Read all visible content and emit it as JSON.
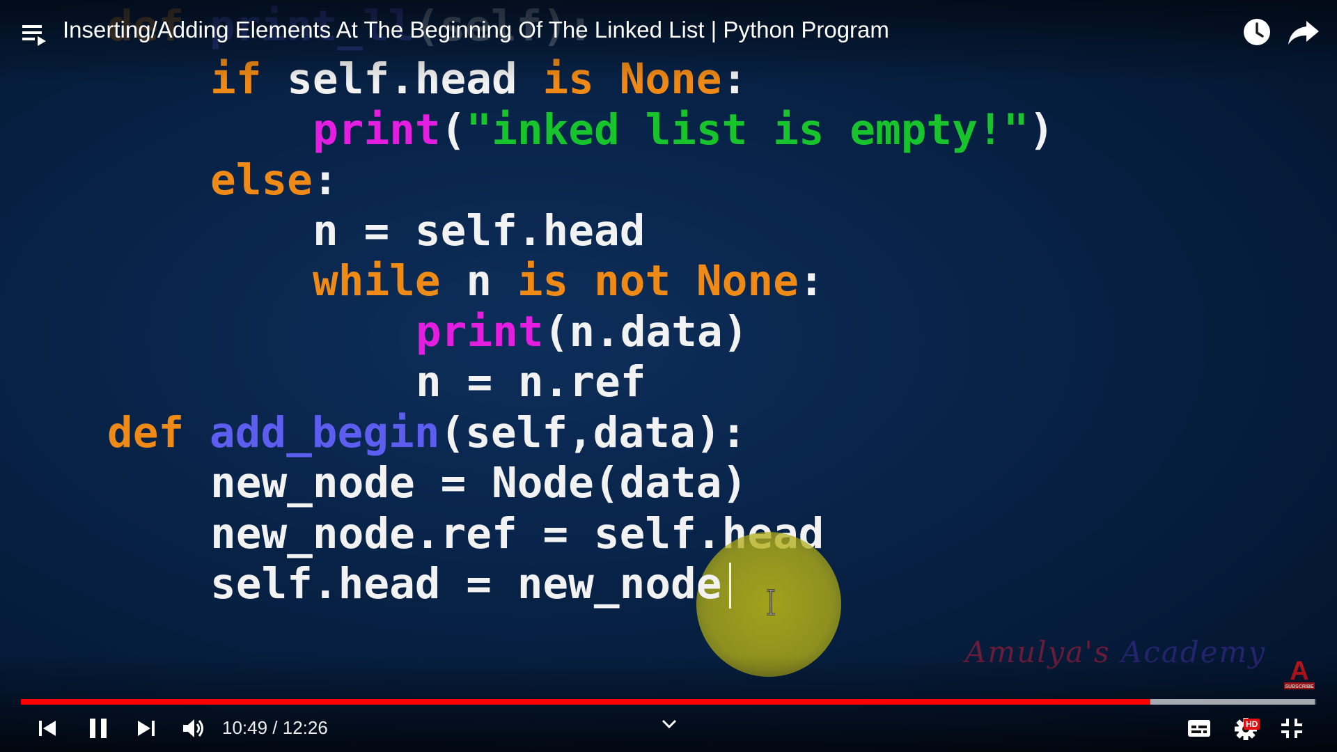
{
  "player": {
    "title": "Inserting/Adding Elements At The Beginning Of The Linked List | Python Program",
    "time_current": "10:49",
    "time_separator": " / ",
    "time_total": "12:26",
    "progress_played_fraction": 0.872,
    "progress_buffered_fraction": 0.999,
    "hd_badge": "HD",
    "icons": {
      "playlist": "playlist-icon",
      "watch_later": "clock-icon",
      "share": "share-arrow-icon",
      "previous": "skip-previous-icon",
      "pause": "pause-icon",
      "next": "skip-next-icon",
      "volume": "volume-icon",
      "chevron": "chevron-down-icon",
      "captions": "captions-icon",
      "settings": "gear-icon",
      "exit_fullscreen": "exit-fullscreen-icon"
    },
    "colors": {
      "progress_played": "#ff0000",
      "background": "#082348"
    }
  },
  "code": {
    "ghost_line": {
      "kw": "def ",
      "fn": "print_ll",
      "rest": "(self):"
    },
    "line1": {
      "kw1": "if",
      "t1": " self.head ",
      "kw2": "is None",
      "t2": ":"
    },
    "line2": {
      "fn": "print",
      "t1": "(",
      "str": "\"inked list is empty!\"",
      "t2": ")"
    },
    "line3": {
      "kw": "else",
      "t": ":"
    },
    "line4": {
      "t": "n = self.head"
    },
    "line5": {
      "kw1": "while",
      "t1": " n ",
      "kw2": "is not None",
      "t2": ":"
    },
    "line6": {
      "fn": "print",
      "t": "(n.data)"
    },
    "line7": {
      "t": "n = n.ref"
    },
    "line8": {
      "kw": "def ",
      "def": "add_begin",
      "t": "(self,data):"
    },
    "line9": {
      "t": "new_node = Node(data)"
    },
    "line10": {
      "t": "new_node.ref = self.head"
    },
    "line11": {
      "t": "self.head = new_node"
    },
    "colors": {
      "keyword": "#f08a16",
      "builtin": "#e41ee0",
      "string": "#17c42c",
      "function_name": "#5d5ef0",
      "text": "#f2f2f2"
    }
  },
  "watermark": {
    "part1": "Amulya's",
    "part2": " Academy",
    "subscribe_letter": "A",
    "subscribe_label": "SUBSCRIBE"
  }
}
